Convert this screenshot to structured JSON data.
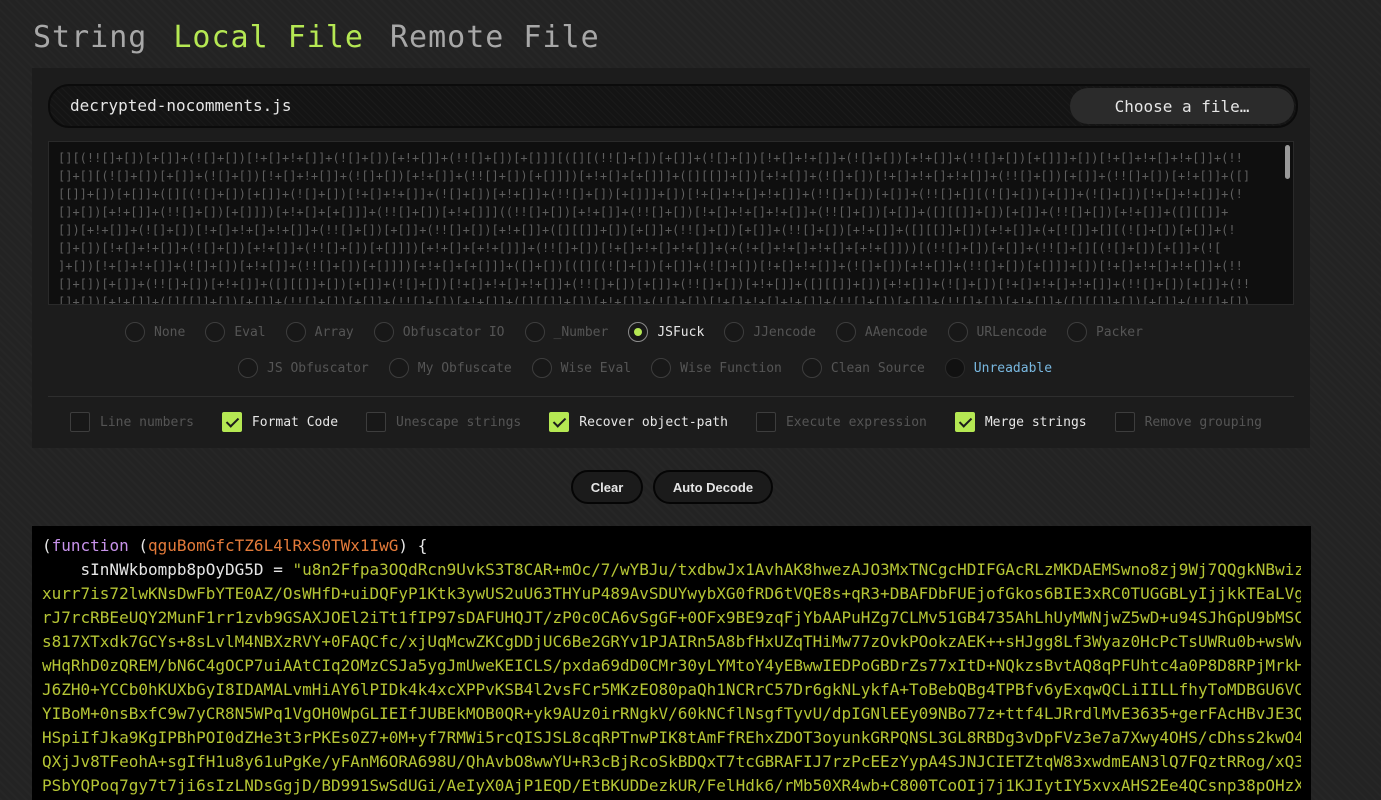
{
  "tabs": [
    {
      "label": "String"
    },
    {
      "label": "Local File"
    },
    {
      "label": "Remote File"
    }
  ],
  "active_tab": "Local File",
  "file": {
    "name": "decrypted-nocomments.js",
    "choose_label": "Choose a file…"
  },
  "input_code": "[][(!![]+[])[+[]]+(![]+[])[!+[]+!+[]]+(![]+[])[+!+[]]+(!![]+[])[+[]]][([][(!![]+[])[+[]]+(![]+[])[!+[]+!+[]]+(![]+[])[+!+[]]+(!![]+[])[+[]]]+[])[!+[]+!+[]+!+[]]+(!!\n[]+[][(![]+[])[+[]]+(![]+[])[!+[]+!+[]]+(![]+[])[+!+[]]+(!![]+[])[+[]]])[+!+[]+[+[]]]+([][[]]+[])[+!+[]]+(![]+[])[!+[]+!+[]+!+[]]+(!![]+[])[+[]]+(!![]+[])[+!+[]]+([]\n[[]]+[])[+[]]+([][(![]+[])[+[]]+(![]+[])[!+[]+!+[]]+(![]+[])[+!+[]]+(!![]+[])[+[]]]+[])[!+[]+!+[]+!+[]]+(!![]+[])[+[]]+(!![]+[][(![]+[])[+[]]+(![]+[])[!+[]+!+[]]+(!\n[]+[])[+!+[]]+(!![]+[])[+[]]])[+!+[]+[+[]]]+(!![]+[])[+!+[]]]((!![]+[])[+!+[]]+(!![]+[])[!+[]+!+[]+!+[]]+(!![]+[])[+[]]+([][[]]+[])[+[]]+(!![]+[])[+!+[]]+([][[]]+\n[])[+!+[]]+(![]+[])[!+[]+!+[]+!+[]]+(!![]+[])[+[]]+(!![]+[])[+!+[]]+([][[]]+[])[+[]]+(!![]+[])[+[]]+(!![]+[])[+!+[]]+([][[]]+[])[+!+[]]+(+[![]]+[][(![]+[])[+[]]+(!\n[]+[])[!+[]+!+[]]+(![]+[])[+!+[]]+(!![]+[])[+[]]])[+!+[]+[+!+[]]]+(!![]+[])[!+[]+!+[]+!+[]]+(+(!+[]+!+[]+!+[]+[+!+[]]))[(!![]+[])[+[]]+(!![]+[][(![]+[])[+[]]+(![\n]+[])[!+[]+!+[]]+(![]+[])[+!+[]]+(!![]+[])[+[]]])[+!+[]+[+[]]]+([]+[])[([][(![]+[])[+[]]+(![]+[])[!+[]+!+[]]+(![]+[])[+!+[]]+(!![]+[])[+[]]]+[])[!+[]+!+[]+!+[]]+(!!\n[]+[])[+[]]+(!![]+[])[+!+[]]+([][[]]+[])[+[]]+(![]+[])[!+[]+!+[]+!+[]]+(!![]+[])[+[]]+(!![]+[])[+!+[]]+([][[]]+[])[+!+[]]+(![]+[])[!+[]+!+[]+!+[]]+(!![]+[])[+[]]+(!!\n[]+[])[+!+[]]+([][[]]+[])[+[]]+(!![]+[])[+[]]+(!![]+[])[+!+[]]+([][[]]+[])[+!+[]]+(![]+[])[!+[]+!+[]+!+[]]+(!![]+[])[+[]]+(!![]+[])[+!+[]]+([][[]]+[])[+[]]+(!![]+[])\n[+!+[]+[+[]]]+([][[]]+[])[+!+[]]+(!![]+[])[+!+[]]+(![]+[])[!+[]+!+[]+!+[]]+([][[]]+[])[+[]]+(!![]+[])[+!+[]]+([][[]]+[])[+!+[]]+(![]+[])[!+[]+!+[]+!+[]]+(!![]+[])",
  "decoders_row1": [
    {
      "label": "None"
    },
    {
      "label": "Eval"
    },
    {
      "label": "Array"
    },
    {
      "label": "Obfuscator IO"
    },
    {
      "label": "_Number"
    },
    {
      "label": "JSFuck"
    },
    {
      "label": "JJencode"
    },
    {
      "label": "AAencode"
    },
    {
      "label": "URLencode"
    },
    {
      "label": "Packer"
    }
  ],
  "decoders_row2": [
    {
      "label": "JS Obfuscator"
    },
    {
      "label": "My Obfuscate"
    },
    {
      "label": "Wise Eval"
    },
    {
      "label": "Wise Function"
    },
    {
      "label": "Clean Source"
    },
    {
      "label": "Unreadable"
    }
  ],
  "selected_decoder": "JSFuck",
  "options": [
    {
      "label": "Line numbers",
      "checked": false
    },
    {
      "label": "Format Code",
      "checked": true
    },
    {
      "label": "Unescape strings",
      "checked": false
    },
    {
      "label": "Recover object-path",
      "checked": true
    },
    {
      "label": "Execute expression",
      "checked": false
    },
    {
      "label": "Merge strings",
      "checked": true
    },
    {
      "label": "Remove grouping",
      "checked": false
    }
  ],
  "buttons": {
    "clear": "Clear",
    "auto_decode": "Auto Decode"
  },
  "output": {
    "open_paren": "(",
    "keyword": "function",
    "param_open": " (",
    "param": "qguBomGfcTZ6L4lRxS0TWx1IwG",
    "param_close": ") {",
    "indent": "    ",
    "var_name": "sInNWkbompb8pOyDG5D",
    "assign": " = ",
    "string_lines": [
      "\"u8n2Ffpa3OQdRcn9UvkS3T8CAR+mOc/7/wYBJu/txdbwJx1AvhAK8hwezAJO3MxTNCgcHDIFGAcRLzMKDAEMSwno8zj9Wj7QQgkNBwiz",
      "xurr7is72lwKNsDwFbYTE0AZ/OsWHfD+uiDQFyP1Ktk3ywUS2uU63THYuP489AvSDUYwybXG0fRD6tVQE8s+qR3+DBAFDbFUEjofGkos6BIE3xRC0TUGGBLyIjjkkTEaLVg",
      "rJ7rcRBEeUQY2MunF1rr1zvb9GSAXJOEl2iTt1fIP97sDAFUHQJT/zP0c0CA6vSgGF+0OFx9BE9zqFjYbAAPuHZg7CLMv51GB4735AhLhUyMWNjwZ5wD+u94SJhGpU9bMSC",
      "s817XTxdk7GCYs+8sLvlM4NBXzRVY+0FAQCfc/xjUqMcwZKCgDDjUC6Be2GRYv1PJAIRn5A8bfHxUZqTHiMw77zOvkPOokzAEK++sHJgg8Lf3Wyaz0HcPcTsUWRu0b+wsWv",
      "wHqRhD0zQREM/bN6C4gOCP7uiAAtCIq2OMzCSJa5ygJmUweKEICLS/pxda69dD0CMr30yLYMtoY4yEBwwIEDPoGBDrZs77xItD+NQkzsBvtAQ8qPFUhtc4a0P8D8RPjMrkH",
      "J6ZH0+YCCb0hKUXbGyI8IDAMALvmHiAY6lPIDk4k4xcXPPvKSB4l2vsFCr5MKzEO80paQh1NCRrC57Dr6gkNLykfA+ToBebQBg4TPBfv6yExqwQCLiIILLfhyToMDBGU6VC",
      "YIBoM+0nsBxfC9w7yCR8N5WPq1VgOH0WpGLIEIfJUBEkMOB0QR+yk9AUz0irRNgkV/60kNCflNsgfTyvU/dpIGNlEEy09NBo77z+ttf4LJRrdlMvE3635+gerFAcHBvJE3Q",
      "HSpiIfJka9KgIPBhPOI0dZHe3t3rPKEs0Z7+0M+yf7RMWi5rcQISJSL8cqRPTnwPIK8tAmFfREhxZDOT3oyunkGRPQNSL3GL8RBDg3vDpFVz3e7a7Xwy4OHS/cDhss2kwO4",
      "QXjJv8TFeohA+sgIfH1u8y61uPgKe/yFAnM6ORA698U/QhAvbO8wwYU+R3cBjRcoSkBDQxT7tcGBRAFIJ7rzPcEEzYypA4SJNJCIETZtqW83xwdmEAN3lQ7FQztRRog/xQ3",
      "PSbYQPoq7gy7t7ji6sIzLNDsGgjD/BD991SwSdUGi/AeIyX0AjP1EQD/EtBKUDDezkUR/FelHdk6/rMb50XR4wb+C800TCoOIj7j1KJIytIY5xvxAHS2Ee4QCsnp38pOHzX"
    ]
  }
}
